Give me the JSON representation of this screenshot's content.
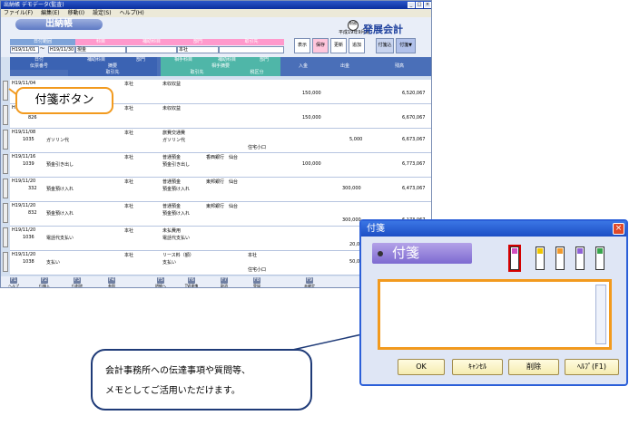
{
  "window": {
    "title": "出納帳 デモデータ(監査)"
  },
  "menu": [
    "ファイル(F)",
    "編集(E)",
    "移動(I)",
    "設定(S)",
    "ヘルプ(H)"
  ],
  "app": {
    "name": "出納帳",
    "brand": "発展会計",
    "period": "平成19年9月期",
    "logo_text": "財務"
  },
  "filters": {
    "labels": [
      "日付範囲",
      "科目",
      "補助科目",
      "部門",
      "取引先"
    ],
    "date_from": "H19/11/01",
    "date_to": "H19/11/30",
    "account": "現金",
    "dept": "本社"
  },
  "actions": [
    "表示",
    "保存",
    "更新",
    "追加",
    "付箋込",
    "付箋▼"
  ],
  "grid_headers": {
    "row1": [
      "日付",
      "補助科目",
      "部門",
      "相手科目",
      "補助科目",
      "部門"
    ],
    "row2": [
      "伝票番号",
      "摘要",
      "相手摘要",
      "入金",
      "出金",
      "残高"
    ],
    "row3": [
      "取引先",
      "取引先",
      "税区分"
    ]
  },
  "rows": [
    {
      "date": "H19/11/04",
      "no": "",
      "dept": "本社",
      "acct": "未収収益",
      "desc": "",
      "in": "150,000",
      "out": "",
      "bal": "6,520,067"
    },
    {
      "date": "H19/11/04",
      "no": "826",
      "dept": "本社",
      "acct": "未収収益",
      "desc": "",
      "in": "150,000",
      "out": "",
      "bal": "6,670,067"
    },
    {
      "date": "H19/11/08",
      "no": "1035",
      "dept": "本社",
      "acct": "旅費交通費",
      "desc": "ガソリン代",
      "desc2": "ガソリン代",
      "extra": "住宅小口",
      "in": "",
      "out": "5,000",
      "bal": "6,673,067"
    },
    {
      "date": "H19/11/16",
      "no": "1039",
      "dept": "本社",
      "acct": "普通預金",
      "acct2": "香西銀行　仙台",
      "desc": "預金引き出し",
      "desc2": "預金引き出し",
      "in": "100,000",
      "out": "",
      "bal": "6,773,067"
    },
    {
      "date": "H19/11/20",
      "no": "332",
      "dept": "本社",
      "acct": "普通預金",
      "acct2": "東邦銀行　仙台",
      "desc": "預金預け入れ",
      "desc2": "預金預け入れ",
      "in": "",
      "out": "300,000",
      "bal": "6,473,067"
    },
    {
      "date": "H19/11/20",
      "no": "832",
      "dept": "本社",
      "acct": "普通預金",
      "acct2": "東邦銀行　仙台",
      "desc": "預金預け入れ",
      "desc2": "預金預け入れ",
      "in": "",
      "out": "300,000",
      "bal": "6,173,067"
    },
    {
      "date": "H19/11/20",
      "no": "1036",
      "dept": "本社",
      "acct": "未払費用",
      "desc": "電話代支払い",
      "desc2": "電話代支払い",
      "in": "",
      "out": "20,000",
      "bal": ""
    },
    {
      "date": "H19/11/20",
      "no": "1038",
      "dept": "本社",
      "acct": "リース料（額）",
      "acct2": "本社",
      "desc": "支払い",
      "desc2": "支払い",
      "extra": "住宅小口",
      "in": "",
      "out": "50,000",
      "bal": ""
    }
  ],
  "fkeys": [
    {
      "key": "F1",
      "label": "ヘルプ"
    },
    {
      "key": "F2",
      "label": "行挿入"
    },
    {
      "key": "F3",
      "label": "行削除"
    },
    {
      "key": "F4",
      "label": "参照"
    },
    {
      "key": "F5",
      "label": "明細へ"
    },
    {
      "key": "F6",
      "label": "TW連携"
    },
    {
      "key": "F7",
      "label": "取消"
    },
    {
      "key": "F8",
      "label": "登録"
    },
    {
      "key": "F9",
      "label": "未確定"
    }
  ],
  "callout_tag_button": "付箋ボタン",
  "dialog": {
    "title": "付箋",
    "label": "付箋",
    "buttons": [
      "OK",
      "ｷｬﾝｾﾙ",
      "削除",
      "ﾍﾙﾌﾟ(F1)"
    ],
    "colors": [
      "#d24fbf",
      "#f1c600",
      "#f19a2c",
      "#8f62d6",
      "#38a54c"
    ]
  },
  "bubble": {
    "line1": "会計事務所への伝達事項や質問等、",
    "line2": "メモとしてご活用いただけます。"
  }
}
